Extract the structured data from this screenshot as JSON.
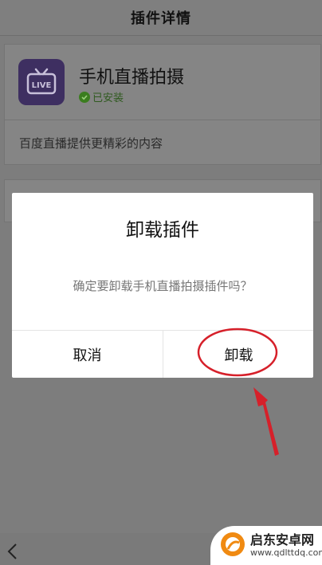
{
  "header": {
    "title": "插件详情"
  },
  "plugin": {
    "name": "手机直播拍摄",
    "status": "已安装",
    "description": "百度直播提供更精彩的内容",
    "icon_text": "LIVE"
  },
  "dialog": {
    "title": "卸载插件",
    "message": "确定要卸载手机直播拍摄插件吗？",
    "cancel_label": "取消",
    "confirm_label": "卸载"
  },
  "watermark": {
    "main": "启东安卓网",
    "url": "www.qdlttdq.com"
  },
  "colors": {
    "annotation": "#d6202a",
    "icon_bg": "#3e2f61",
    "installed": "#3b7d1f"
  }
}
